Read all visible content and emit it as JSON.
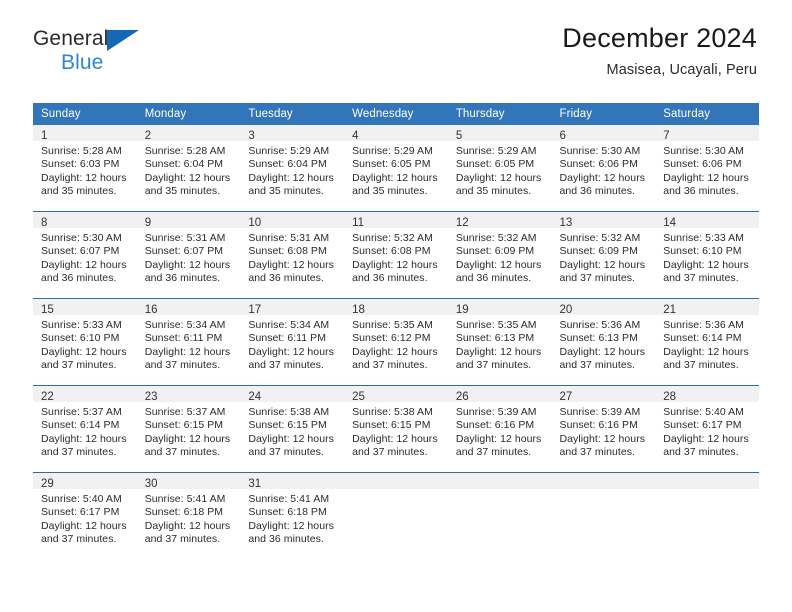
{
  "logo": {
    "word1": "General",
    "word2": "Blue",
    "triangle_color": "#1668b3",
    "word2_color": "#2f86d4"
  },
  "header": {
    "title": "December 2024",
    "location": "Masisea, Ucayali, Peru"
  },
  "theme": {
    "header_blue": "#3275b8",
    "grid_line": "#2e6ca8",
    "daynum_band": "#f1f1f1",
    "text": "#2b2b2b"
  },
  "weekday_headers": [
    "Sunday",
    "Monday",
    "Tuesday",
    "Wednesday",
    "Thursday",
    "Friday",
    "Saturday"
  ],
  "weeks": [
    [
      {
        "day": "1",
        "sunrise": "Sunrise: 5:28 AM",
        "sunset": "Sunset: 6:03 PM",
        "daylight1": "Daylight: 12 hours",
        "daylight2": "and 35 minutes."
      },
      {
        "day": "2",
        "sunrise": "Sunrise: 5:28 AM",
        "sunset": "Sunset: 6:04 PM",
        "daylight1": "Daylight: 12 hours",
        "daylight2": "and 35 minutes."
      },
      {
        "day": "3",
        "sunrise": "Sunrise: 5:29 AM",
        "sunset": "Sunset: 6:04 PM",
        "daylight1": "Daylight: 12 hours",
        "daylight2": "and 35 minutes."
      },
      {
        "day": "4",
        "sunrise": "Sunrise: 5:29 AM",
        "sunset": "Sunset: 6:05 PM",
        "daylight1": "Daylight: 12 hours",
        "daylight2": "and 35 minutes."
      },
      {
        "day": "5",
        "sunrise": "Sunrise: 5:29 AM",
        "sunset": "Sunset: 6:05 PM",
        "daylight1": "Daylight: 12 hours",
        "daylight2": "and 35 minutes."
      },
      {
        "day": "6",
        "sunrise": "Sunrise: 5:30 AM",
        "sunset": "Sunset: 6:06 PM",
        "daylight1": "Daylight: 12 hours",
        "daylight2": "and 36 minutes."
      },
      {
        "day": "7",
        "sunrise": "Sunrise: 5:30 AM",
        "sunset": "Sunset: 6:06 PM",
        "daylight1": "Daylight: 12 hours",
        "daylight2": "and 36 minutes."
      }
    ],
    [
      {
        "day": "8",
        "sunrise": "Sunrise: 5:30 AM",
        "sunset": "Sunset: 6:07 PM",
        "daylight1": "Daylight: 12 hours",
        "daylight2": "and 36 minutes."
      },
      {
        "day": "9",
        "sunrise": "Sunrise: 5:31 AM",
        "sunset": "Sunset: 6:07 PM",
        "daylight1": "Daylight: 12 hours",
        "daylight2": "and 36 minutes."
      },
      {
        "day": "10",
        "sunrise": "Sunrise: 5:31 AM",
        "sunset": "Sunset: 6:08 PM",
        "daylight1": "Daylight: 12 hours",
        "daylight2": "and 36 minutes."
      },
      {
        "day": "11",
        "sunrise": "Sunrise: 5:32 AM",
        "sunset": "Sunset: 6:08 PM",
        "daylight1": "Daylight: 12 hours",
        "daylight2": "and 36 minutes."
      },
      {
        "day": "12",
        "sunrise": "Sunrise: 5:32 AM",
        "sunset": "Sunset: 6:09 PM",
        "daylight1": "Daylight: 12 hours",
        "daylight2": "and 36 minutes."
      },
      {
        "day": "13",
        "sunrise": "Sunrise: 5:32 AM",
        "sunset": "Sunset: 6:09 PM",
        "daylight1": "Daylight: 12 hours",
        "daylight2": "and 37 minutes."
      },
      {
        "day": "14",
        "sunrise": "Sunrise: 5:33 AM",
        "sunset": "Sunset: 6:10 PM",
        "daylight1": "Daylight: 12 hours",
        "daylight2": "and 37 minutes."
      }
    ],
    [
      {
        "day": "15",
        "sunrise": "Sunrise: 5:33 AM",
        "sunset": "Sunset: 6:10 PM",
        "daylight1": "Daylight: 12 hours",
        "daylight2": "and 37 minutes."
      },
      {
        "day": "16",
        "sunrise": "Sunrise: 5:34 AM",
        "sunset": "Sunset: 6:11 PM",
        "daylight1": "Daylight: 12 hours",
        "daylight2": "and 37 minutes."
      },
      {
        "day": "17",
        "sunrise": "Sunrise: 5:34 AM",
        "sunset": "Sunset: 6:11 PM",
        "daylight1": "Daylight: 12 hours",
        "daylight2": "and 37 minutes."
      },
      {
        "day": "18",
        "sunrise": "Sunrise: 5:35 AM",
        "sunset": "Sunset: 6:12 PM",
        "daylight1": "Daylight: 12 hours",
        "daylight2": "and 37 minutes."
      },
      {
        "day": "19",
        "sunrise": "Sunrise: 5:35 AM",
        "sunset": "Sunset: 6:13 PM",
        "daylight1": "Daylight: 12 hours",
        "daylight2": "and 37 minutes."
      },
      {
        "day": "20",
        "sunrise": "Sunrise: 5:36 AM",
        "sunset": "Sunset: 6:13 PM",
        "daylight1": "Daylight: 12 hours",
        "daylight2": "and 37 minutes."
      },
      {
        "day": "21",
        "sunrise": "Sunrise: 5:36 AM",
        "sunset": "Sunset: 6:14 PM",
        "daylight1": "Daylight: 12 hours",
        "daylight2": "and 37 minutes."
      }
    ],
    [
      {
        "day": "22",
        "sunrise": "Sunrise: 5:37 AM",
        "sunset": "Sunset: 6:14 PM",
        "daylight1": "Daylight: 12 hours",
        "daylight2": "and 37 minutes."
      },
      {
        "day": "23",
        "sunrise": "Sunrise: 5:37 AM",
        "sunset": "Sunset: 6:15 PM",
        "daylight1": "Daylight: 12 hours",
        "daylight2": "and 37 minutes."
      },
      {
        "day": "24",
        "sunrise": "Sunrise: 5:38 AM",
        "sunset": "Sunset: 6:15 PM",
        "daylight1": "Daylight: 12 hours",
        "daylight2": "and 37 minutes."
      },
      {
        "day": "25",
        "sunrise": "Sunrise: 5:38 AM",
        "sunset": "Sunset: 6:15 PM",
        "daylight1": "Daylight: 12 hours",
        "daylight2": "and 37 minutes."
      },
      {
        "day": "26",
        "sunrise": "Sunrise: 5:39 AM",
        "sunset": "Sunset: 6:16 PM",
        "daylight1": "Daylight: 12 hours",
        "daylight2": "and 37 minutes."
      },
      {
        "day": "27",
        "sunrise": "Sunrise: 5:39 AM",
        "sunset": "Sunset: 6:16 PM",
        "daylight1": "Daylight: 12 hours",
        "daylight2": "and 37 minutes."
      },
      {
        "day": "28",
        "sunrise": "Sunrise: 5:40 AM",
        "sunset": "Sunset: 6:17 PM",
        "daylight1": "Daylight: 12 hours",
        "daylight2": "and 37 minutes."
      }
    ],
    [
      {
        "day": "29",
        "sunrise": "Sunrise: 5:40 AM",
        "sunset": "Sunset: 6:17 PM",
        "daylight1": "Daylight: 12 hours",
        "daylight2": "and 37 minutes."
      },
      {
        "day": "30",
        "sunrise": "Sunrise: 5:41 AM",
        "sunset": "Sunset: 6:18 PM",
        "daylight1": "Daylight: 12 hours",
        "daylight2": "and 37 minutes."
      },
      {
        "day": "31",
        "sunrise": "Sunrise: 5:41 AM",
        "sunset": "Sunset: 6:18 PM",
        "daylight1": "Daylight: 12 hours",
        "daylight2": "and 36 minutes."
      },
      {
        "day": "",
        "sunrise": "",
        "sunset": "",
        "daylight1": "",
        "daylight2": ""
      },
      {
        "day": "",
        "sunrise": "",
        "sunset": "",
        "daylight1": "",
        "daylight2": ""
      },
      {
        "day": "",
        "sunrise": "",
        "sunset": "",
        "daylight1": "",
        "daylight2": ""
      },
      {
        "day": "",
        "sunrise": "",
        "sunset": "",
        "daylight1": "",
        "daylight2": ""
      }
    ]
  ]
}
